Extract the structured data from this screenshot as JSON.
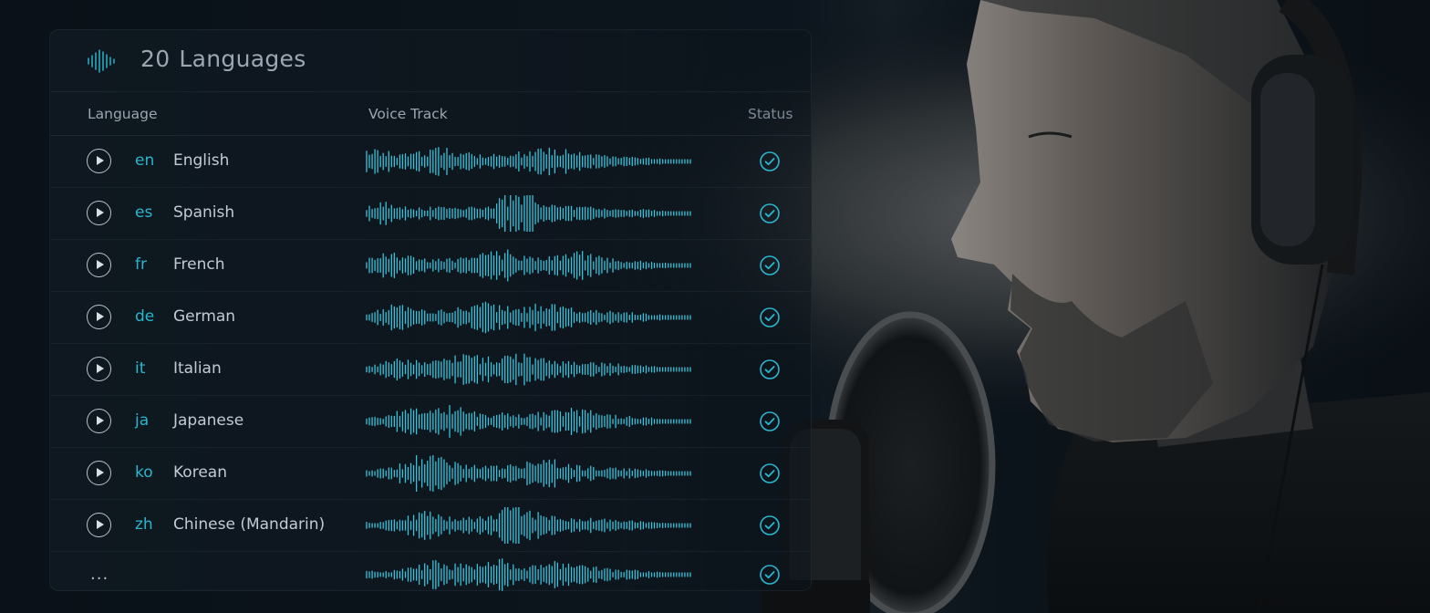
{
  "header": {
    "brand_icon": "audio-waveform-icon",
    "count": "20",
    "title": "Languages"
  },
  "columns": {
    "language": "Language",
    "voice_track": "Voice Track",
    "status": "Status"
  },
  "rows": [
    {
      "code": "en",
      "name": "English",
      "status": "check-circle-icon"
    },
    {
      "code": "es",
      "name": "Spanish",
      "status": "check-circle-icon"
    },
    {
      "code": "fr",
      "name": "French",
      "status": "check-circle-icon"
    },
    {
      "code": "de",
      "name": "German",
      "status": "check-circle-icon"
    },
    {
      "code": "it",
      "name": "Italian",
      "status": "check-circle-icon"
    },
    {
      "code": "ja",
      "name": "Japanese",
      "status": "check-circle-icon"
    },
    {
      "code": "ko",
      "name": "Korean",
      "status": "check-circle-icon"
    },
    {
      "code": "zh",
      "name": "Chinese (Mandarin)",
      "status": "check-circle-icon"
    }
  ],
  "more_row": {
    "label": "...",
    "status": "check-circle-icon"
  },
  "colors": {
    "accent": "#2ab6d0",
    "waveform": "#36c4dc",
    "text_primary": "#c3cbd2",
    "panel_background": "#101921"
  }
}
